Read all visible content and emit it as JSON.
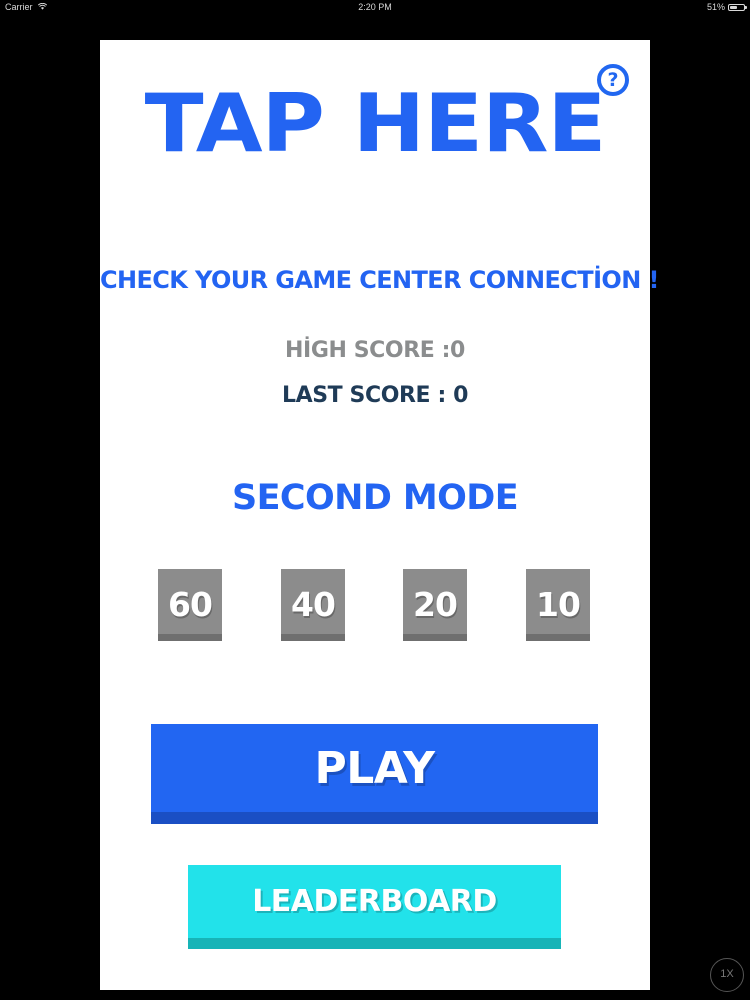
{
  "status_bar": {
    "carrier": "Carrier",
    "wifi_icon": "wifi-icon",
    "time": "2:20 PM",
    "battery": "51%",
    "battery_level": 0.51
  },
  "game": {
    "help_label": "?",
    "tap_here": "TAP HERE",
    "connection_message": "CHECK YOUR GAME CENTER CONNECTİON !",
    "high_score": "HİGH SCORE :0",
    "last_score": "LAST SCORE : 0",
    "mode_title": "SECOND MODE",
    "modes": [
      "60",
      "40",
      "20",
      "10"
    ],
    "play_label": "PLAY",
    "leaderboard_label": "LEADERBOARD"
  },
  "zoom": "1X",
  "colors": {
    "background": "#000000",
    "panel": "#ffffff",
    "primary_blue": "#2266f2",
    "cyan": "#22e2ea",
    "mode_gray": "#8c8c8c",
    "dark_navy": "#1f3b57"
  }
}
